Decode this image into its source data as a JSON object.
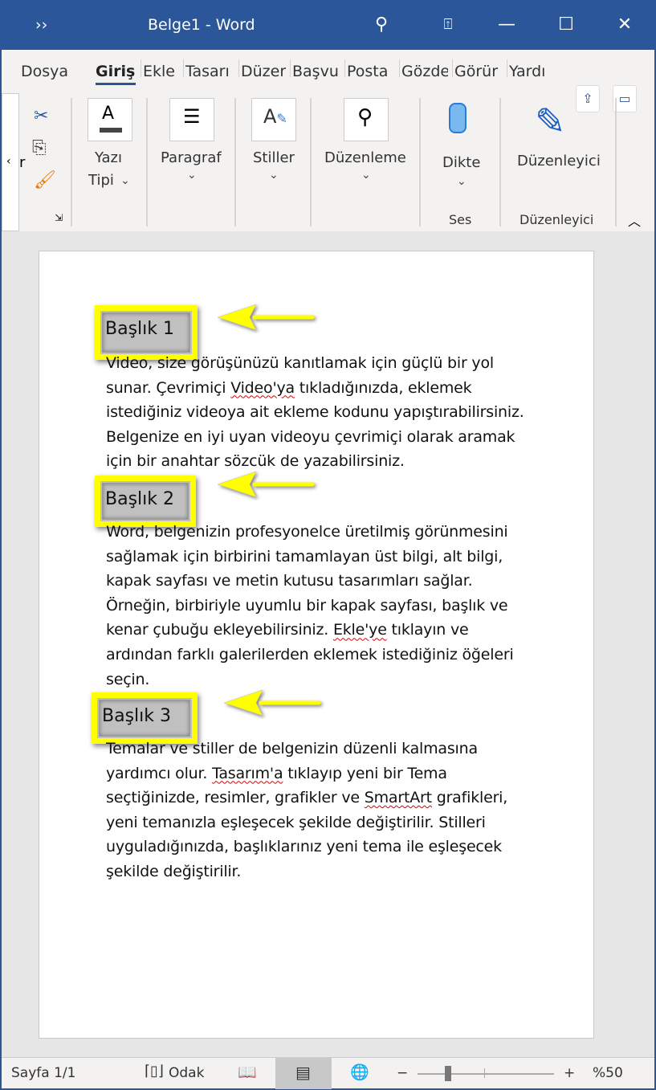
{
  "titlebar": {
    "qat": "››",
    "title": "Belge1  -  Word",
    "icons": [
      "search-icon",
      "restore-ribbon-icon",
      "minimize-icon",
      "maximize-icon",
      "close-icon"
    ]
  },
  "tabs": [
    {
      "label": "Dosya"
    },
    {
      "label": "Giriş",
      "selected": true
    },
    {
      "label": "Ekle"
    },
    {
      "label": "Tasarı"
    },
    {
      "label": "Düzer"
    },
    {
      "label": "Başvu"
    },
    {
      "label": "Posta"
    },
    {
      "label": "Gözde"
    },
    {
      "label": "Görür"
    },
    {
      "label": "Yardı"
    }
  ],
  "ribbon": {
    "clipboard_partial": "r",
    "groups": [
      {
        "label": "Yazı",
        "label2": "Tipi"
      },
      {
        "label": "Paragraf"
      },
      {
        "label": "Stiller"
      },
      {
        "label": "Düzenleme"
      },
      {
        "label": "Dikte",
        "group": "Ses"
      },
      {
        "label": "Düzenleyici",
        "group": "Düzenleyici"
      }
    ]
  },
  "document": {
    "headings": [
      "Başlık 1",
      "Başlık 2",
      "Başlık 3"
    ],
    "misspelled": [
      "Video'ya",
      "Ekle'ye",
      "Tasarım'a",
      "SmartArt"
    ],
    "paragraphs": [
      [
        "Video, size görüşünüzü kanıtlamak için güçlü bir yol",
        "sunar. Çevrimiçi Video'ya tıkladığınızda, eklemek",
        "istediğiniz videoya ait ekleme kodunu yapıştırabilirsiniz.",
        "Belgenize en iyi uyan videoyu çevrimiçi olarak aramak",
        "için bir anahtar sözcük de yazabilirsiniz."
      ],
      [
        "Word, belgenizin profesyonelce üretilmiş görünmesini",
        "sağlamak için birbirini tamamlayan üst bilgi, alt bilgi,",
        "kapak sayfası ve metin kutusu tasarımları sağlar.",
        "Örneğin, birbiriyle uyumlu bir kapak sayfası, başlık ve",
        "kenar çubuğu ekleyebilirsiniz. Ekle'ye tıklayın ve",
        "ardından farklı galerilerden eklemek istediğiniz öğeleri",
        "seçin."
      ],
      [
        "Temalar ve stiller de belgenizin düzenli kalmasına",
        "yardımcı olur. Tasarım'a tıklayıp yeni bir Tema",
        "seçtiğinizde, resimler, grafikler ve SmartArt grafikleri,",
        "yeni temanızla eşleşecek şekilde değiştirilir. Stilleri",
        "uyguladığınızda, başlıklarınız yeni tema ile eşleşecek",
        "şekilde değiştirilir."
      ]
    ],
    "annotation_color": "#ffff00"
  },
  "status": {
    "page": "Sayfa 1/1",
    "focus": "Odak",
    "zoom": "%50",
    "zoom_percent": 50,
    "minus": "−",
    "plus": "+"
  }
}
